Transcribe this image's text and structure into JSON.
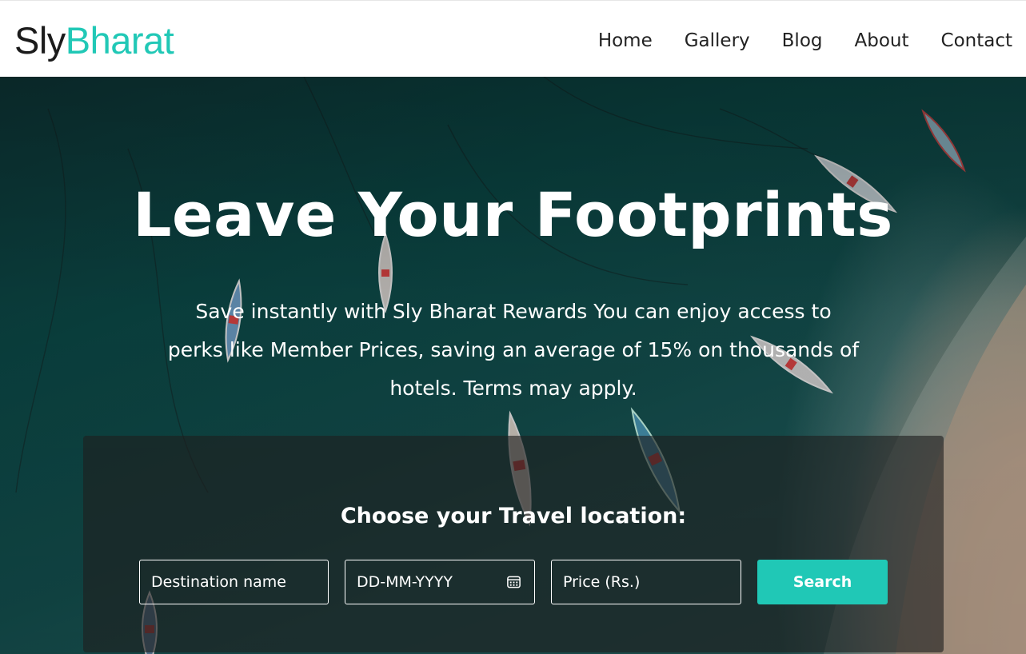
{
  "brand": {
    "part1": "Sly",
    "part2": "Bharat",
    "accent_color": "#21c8b6"
  },
  "nav": {
    "items": [
      "Home",
      "Gallery",
      "Blog",
      "About",
      "Contact"
    ]
  },
  "hero": {
    "title": "Leave Your Footprints",
    "subtitle": "Save instantly with Sly Bharat Rewards You can enjoy access to perks like Member Prices, saving an average of 15% on thousands of hotels. Terms may apply.",
    "background_image": "aerial view of boats in turquoise sea near beach"
  },
  "search_panel": {
    "title": "Choose your Travel location:",
    "destination_placeholder": "Destination name",
    "date_placeholder": "DD-MM-YYYY",
    "price_placeholder": "Price (Rs.)",
    "search_label": "Search",
    "calendar_icon": "calendar-icon",
    "button_color": "#20c8b6"
  }
}
